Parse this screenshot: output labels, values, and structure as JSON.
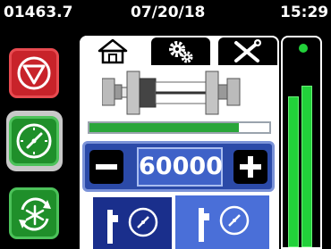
{
  "header": {
    "counter": "01463.7",
    "date": "07/20/18",
    "time": "15:29"
  },
  "sidebar": {
    "stop_icon": "stop-icon",
    "mode_icon": "gauge-icon",
    "defrost_icon": "defrost-icon"
  },
  "tabs": [
    {
      "id": "home",
      "icon": "home-icon",
      "active": true
    },
    {
      "id": "settings",
      "icon": "gears-icon",
      "active": false
    },
    {
      "id": "tools",
      "icon": "tools-icon",
      "active": false
    }
  ],
  "progress": {
    "fraction": 0.83,
    "color": "#2aa63a"
  },
  "stepper": {
    "value": "60000",
    "minus_icon": "minus-icon",
    "plus_icon": "plus-icon"
  },
  "modes": [
    {
      "icon": "valve-gauge-icon",
      "selected": true
    },
    {
      "icon": "valve-gauge-icon",
      "selected": false
    }
  ],
  "meter": {
    "levels": [
      0.72,
      0.77
    ],
    "status_color": "#22d13a"
  }
}
